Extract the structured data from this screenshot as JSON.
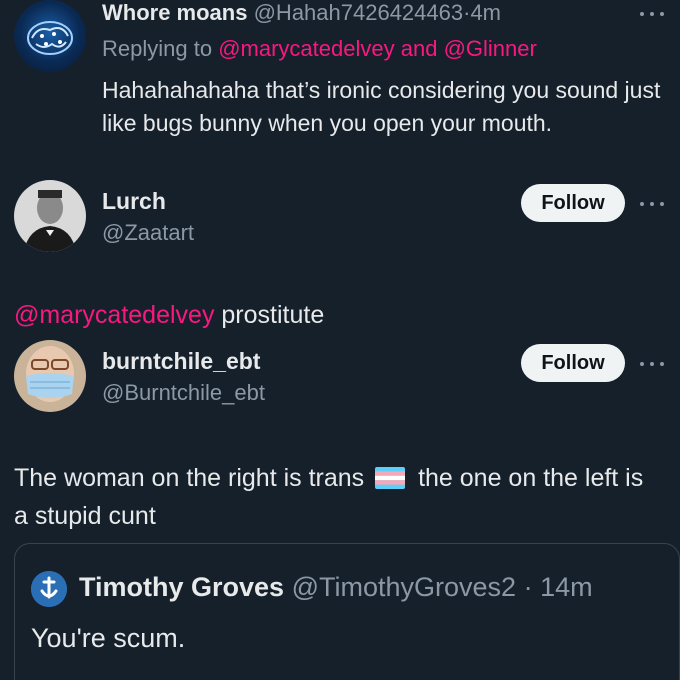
{
  "reply": {
    "display_name": "Whore moans",
    "handle": "@Hahah7426424463",
    "separator": "·",
    "time": "4m",
    "replying_prefix": "Replying to",
    "replying_to_1": "@marycatedelvey",
    "replying_and": "and",
    "replying_to_2": "@Glinner",
    "text": "Hahahahahaha that’s ironic considering you sound just like bugs bunny when you open your mouth."
  },
  "users": [
    {
      "display_name": "Lurch",
      "handle": "@Zaatart",
      "follow_label": "Follow"
    },
    {
      "display_name": "burntchile_ebt",
      "handle": "@Burntchile_ebt",
      "follow_label": "Follow"
    }
  ],
  "between": {
    "mention": "@marycatedelvey",
    "text": "prostitute"
  },
  "post": {
    "text_before_flag": "The woman on the right is trans",
    "flag_icon": "transgender-flag-icon",
    "text_after_flag": "the one on the left is a stupid cunt"
  },
  "quote": {
    "display_name": "Timothy Groves",
    "handle": "@TimothyGroves2",
    "separator": "·",
    "time": "14m",
    "text": "You're scum."
  },
  "colors": {
    "background": "#15202b",
    "text": "#e7e9ea",
    "muted": "#8b98a5",
    "mention": "#f91880",
    "follow_bg": "#eff3f4"
  }
}
